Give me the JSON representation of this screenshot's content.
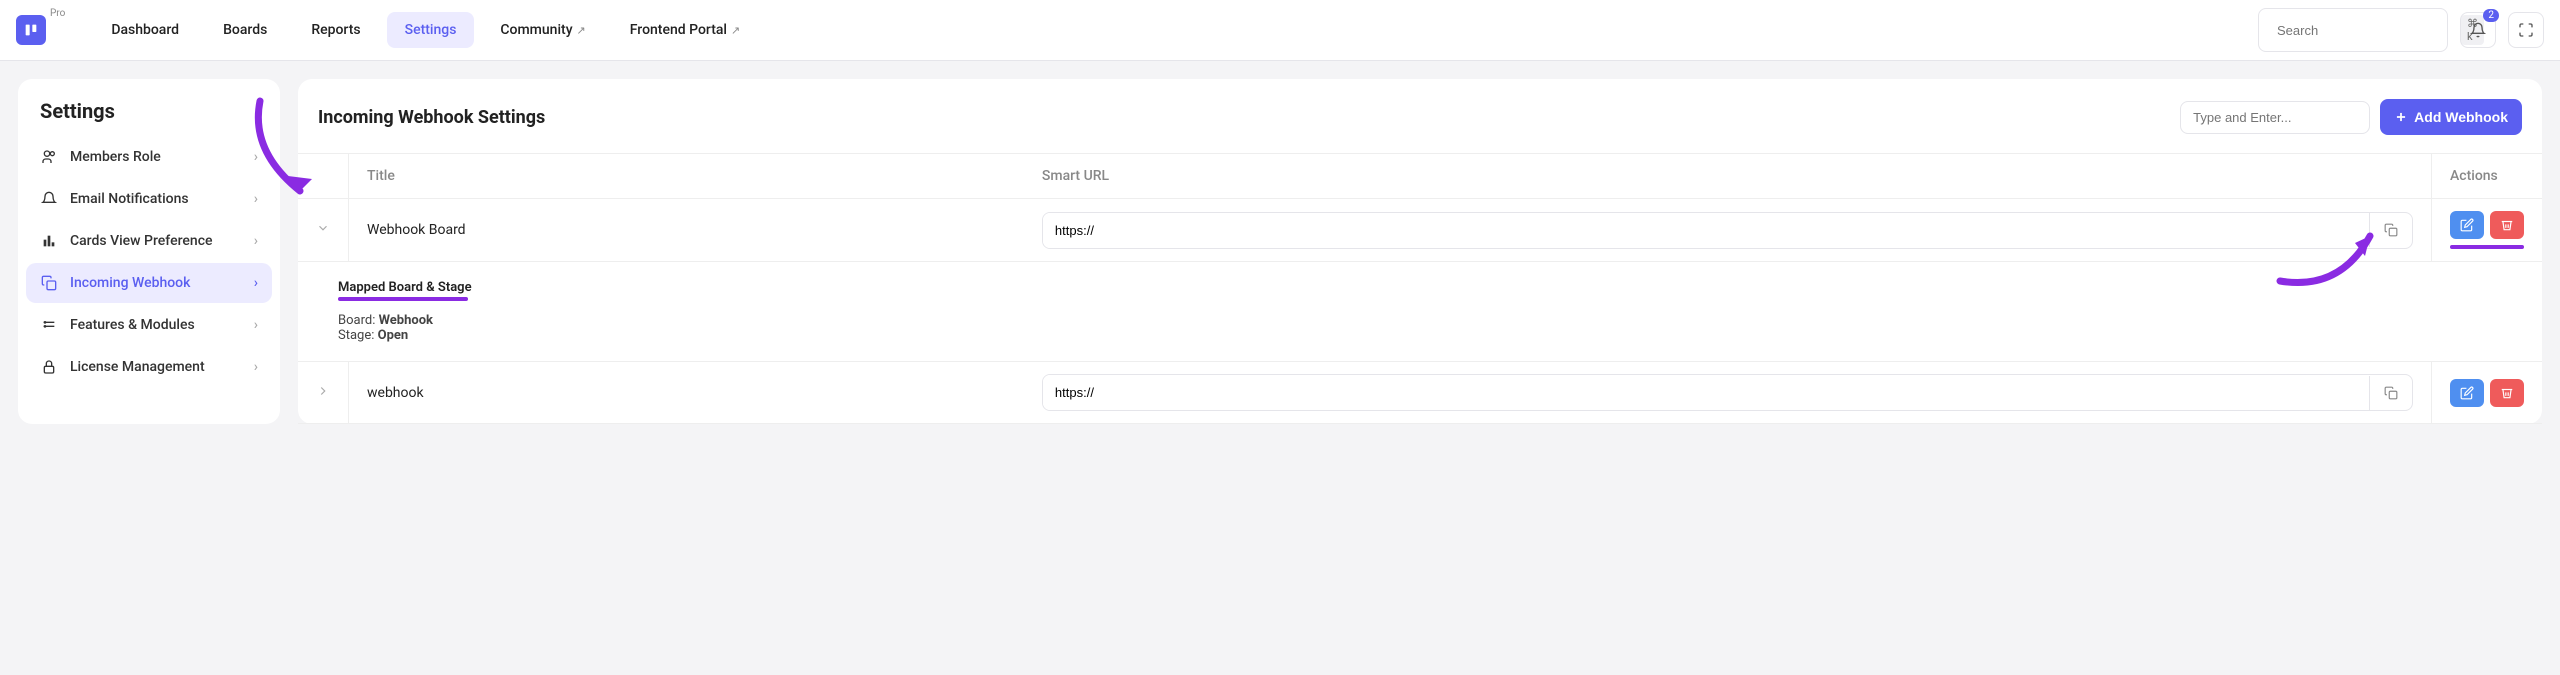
{
  "topbar": {
    "pro_label": "Pro",
    "nav": [
      {
        "label": "Dashboard",
        "active": false
      },
      {
        "label": "Boards",
        "active": false
      },
      {
        "label": "Reports",
        "active": false
      },
      {
        "label": "Settings",
        "active": true
      },
      {
        "label": "Community",
        "active": false,
        "external": true
      },
      {
        "label": "Frontend Portal",
        "active": false,
        "external": true
      }
    ],
    "search_placeholder": "Search",
    "search_kbd": "⌘ k",
    "notif_count": "2"
  },
  "sidebar": {
    "title": "Settings",
    "items": [
      {
        "label": "Members Role",
        "icon": "users"
      },
      {
        "label": "Email Notifications",
        "icon": "bell"
      },
      {
        "label": "Cards View Preference",
        "icon": "chart"
      },
      {
        "label": "Incoming Webhook",
        "icon": "copy",
        "active": true
      },
      {
        "label": "Features & Modules",
        "icon": "layers"
      },
      {
        "label": "License Management",
        "icon": "lock"
      }
    ]
  },
  "content": {
    "title": "Incoming Webhook Settings",
    "filter_placeholder": "Type and Enter...",
    "add_label": "Add Webhook",
    "columns": {
      "title": "Title",
      "url": "Smart URL",
      "actions": "Actions"
    },
    "rows": [
      {
        "title": "Webhook Board",
        "url": "https://",
        "expanded": true,
        "mapped": {
          "heading": "Mapped Board & Stage",
          "board_label": "Board:",
          "board_value": "Webhook",
          "stage_label": "Stage:",
          "stage_value": "Open"
        }
      },
      {
        "title": "webhook",
        "url": "https://",
        "expanded": false
      }
    ]
  }
}
